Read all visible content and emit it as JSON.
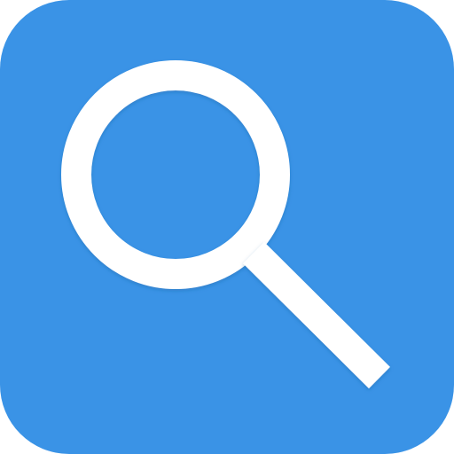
{
  "icon": {
    "name": "search-icon",
    "background_color": "#3a93e6",
    "glyph_color": "#ffffff",
    "shadow_color": "#1f5f9a"
  }
}
